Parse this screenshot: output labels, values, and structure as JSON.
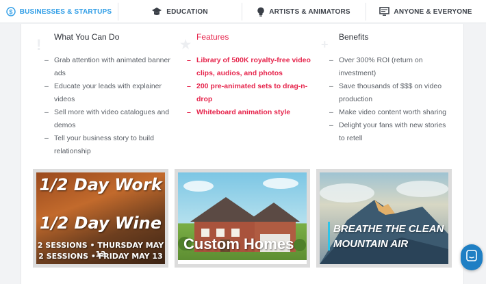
{
  "tabs": [
    {
      "label": "BUSINESSES & STARTUPS",
      "icon": "dollar-circle-icon",
      "active": true
    },
    {
      "label": "EDUCATION",
      "icon": "graduation-cap-icon",
      "active": false
    },
    {
      "label": "ARTISTS & ANIMATORS",
      "icon": "lightbulb-icon",
      "active": false
    },
    {
      "label": "ANYONE & EVERYONE",
      "icon": "monitor-icon",
      "active": false
    }
  ],
  "columns": {
    "what": {
      "title": "What You Can Do",
      "items": [
        "Grab attention with animated banner ads",
        "Educate your leads with explainer videos",
        "Sell more with video catalogues and demos",
        "Tell your business story to build relationship"
      ]
    },
    "features": {
      "title": "Features",
      "items": [
        "Library of 500K royalty-free video clips, audios, and photos",
        "200 pre-animated sets to drag-n-drop",
        "Whiteboard animation style"
      ]
    },
    "benefits": {
      "title": "Benefits",
      "items": [
        "Over 300% ROI (return on investment)",
        "Save thousands of $$$ on video production",
        "Make video content worth sharing",
        "Delight your fans with new stories to retell"
      ]
    }
  },
  "thumbnails": {
    "wine": {
      "line1": "1/2 Day Work",
      "line2": "1/2 Day Wine",
      "line3": "2 SESSIONS • THURSDAY MAY 12",
      "line4": "2 SESSIONS • FRIDAY MAY 13"
    },
    "homes": {
      "caption": "Custom Homes"
    },
    "air": {
      "line1": "BREATHE THE CLEAN",
      "line2": "MOUNTAIN AIR"
    }
  },
  "colors": {
    "accent_blue": "#2d9ce6",
    "feature_red": "#e6264d",
    "chat_blue": "#1f7fc4"
  },
  "chat_widget": {
    "icon": "chat-icon"
  }
}
